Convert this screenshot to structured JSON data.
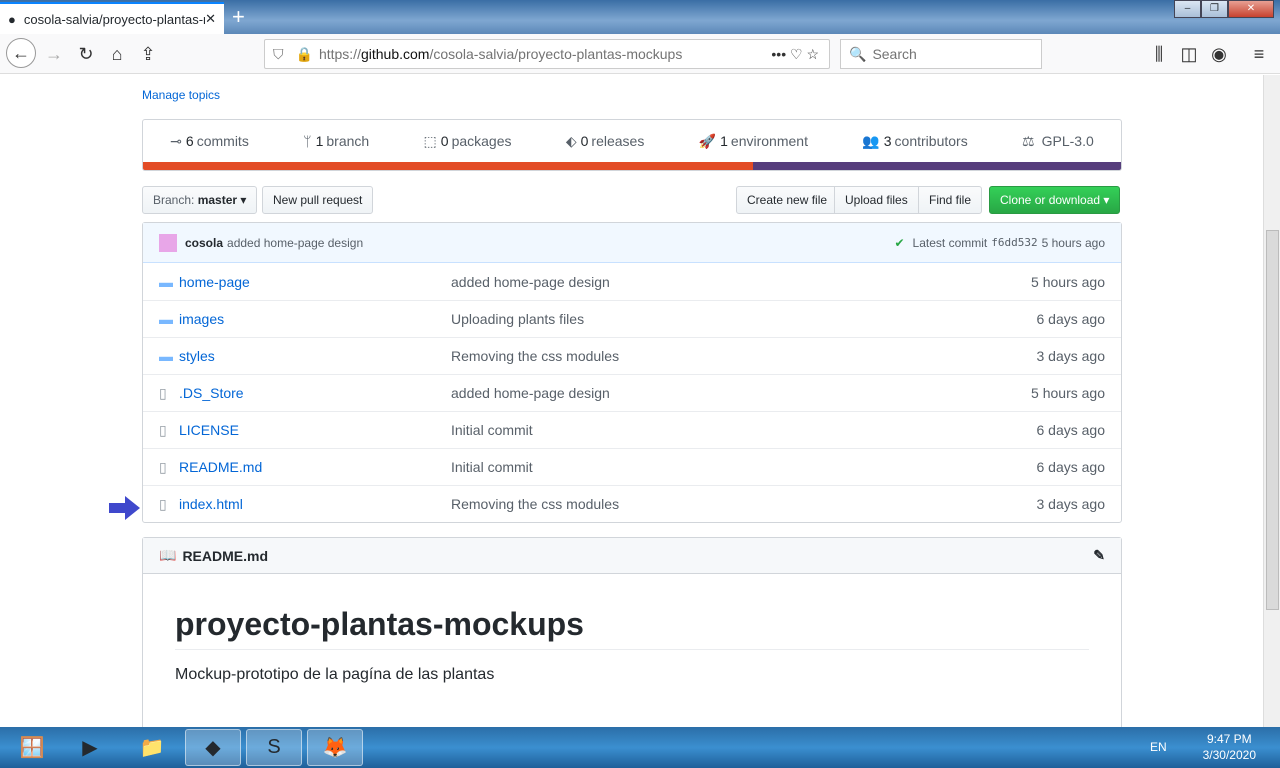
{
  "browser": {
    "tab_title": "cosola-salvia/proyecto-plantas-mockups",
    "url_prefix": "https://",
    "url_domain": "github.com",
    "url_path": "/cosola-salvia/proyecto-plantas-mockups",
    "search_placeholder": "Search"
  },
  "repo": {
    "manage_topics": "Manage topics",
    "stats": [
      {
        "count": "6",
        "label": "commits"
      },
      {
        "count": "1",
        "label": "branch"
      },
      {
        "count": "0",
        "label": "packages"
      },
      {
        "count": "0",
        "label": "releases"
      },
      {
        "count": "1",
        "label": "environment"
      },
      {
        "count": "3",
        "label": "contributors"
      },
      {
        "count": "",
        "label": "GPL-3.0"
      }
    ],
    "language_bar": [
      {
        "color": "#e34c26",
        "fraction": 0.624
      },
      {
        "color": "#563d7c",
        "fraction": 0.376
      }
    ],
    "branch_label": "Branch:",
    "branch": "master",
    "new_pr": "New pull request",
    "create_file": "Create new file",
    "upload": "Upload files",
    "find": "Find file",
    "clone": "Clone or download",
    "commit": {
      "author": "cosola",
      "message": "added home-page design",
      "latest_label": "Latest commit",
      "sha": "f6dd532",
      "age": "5 hours ago"
    },
    "files": [
      {
        "type": "dir",
        "name": "home-page",
        "msg": "added home-page design",
        "age": "5 hours ago"
      },
      {
        "type": "dir",
        "name": "images",
        "msg": "Uploading plants files",
        "age": "6 days ago"
      },
      {
        "type": "dir",
        "name": "styles",
        "msg": "Removing the css modules",
        "age": "3 days ago"
      },
      {
        "type": "file",
        "name": ".DS_Store",
        "msg": "added home-page design",
        "age": "5 hours ago"
      },
      {
        "type": "file",
        "name": "LICENSE",
        "msg": "Initial commit",
        "age": "6 days ago"
      },
      {
        "type": "file",
        "name": "README.md",
        "msg": "Initial commit",
        "age": "6 days ago"
      },
      {
        "type": "file",
        "name": "index.html",
        "msg": "Removing the css modules",
        "age": "3 days ago"
      }
    ],
    "readme": {
      "filename": "README.md",
      "title": "proyecto-plantas-mockups",
      "text": "Mockup-prototipo de la pagína de las plantas"
    }
  },
  "taskbar": {
    "lang": "EN",
    "time": "9:47 PM",
    "date": "3/30/2020"
  }
}
